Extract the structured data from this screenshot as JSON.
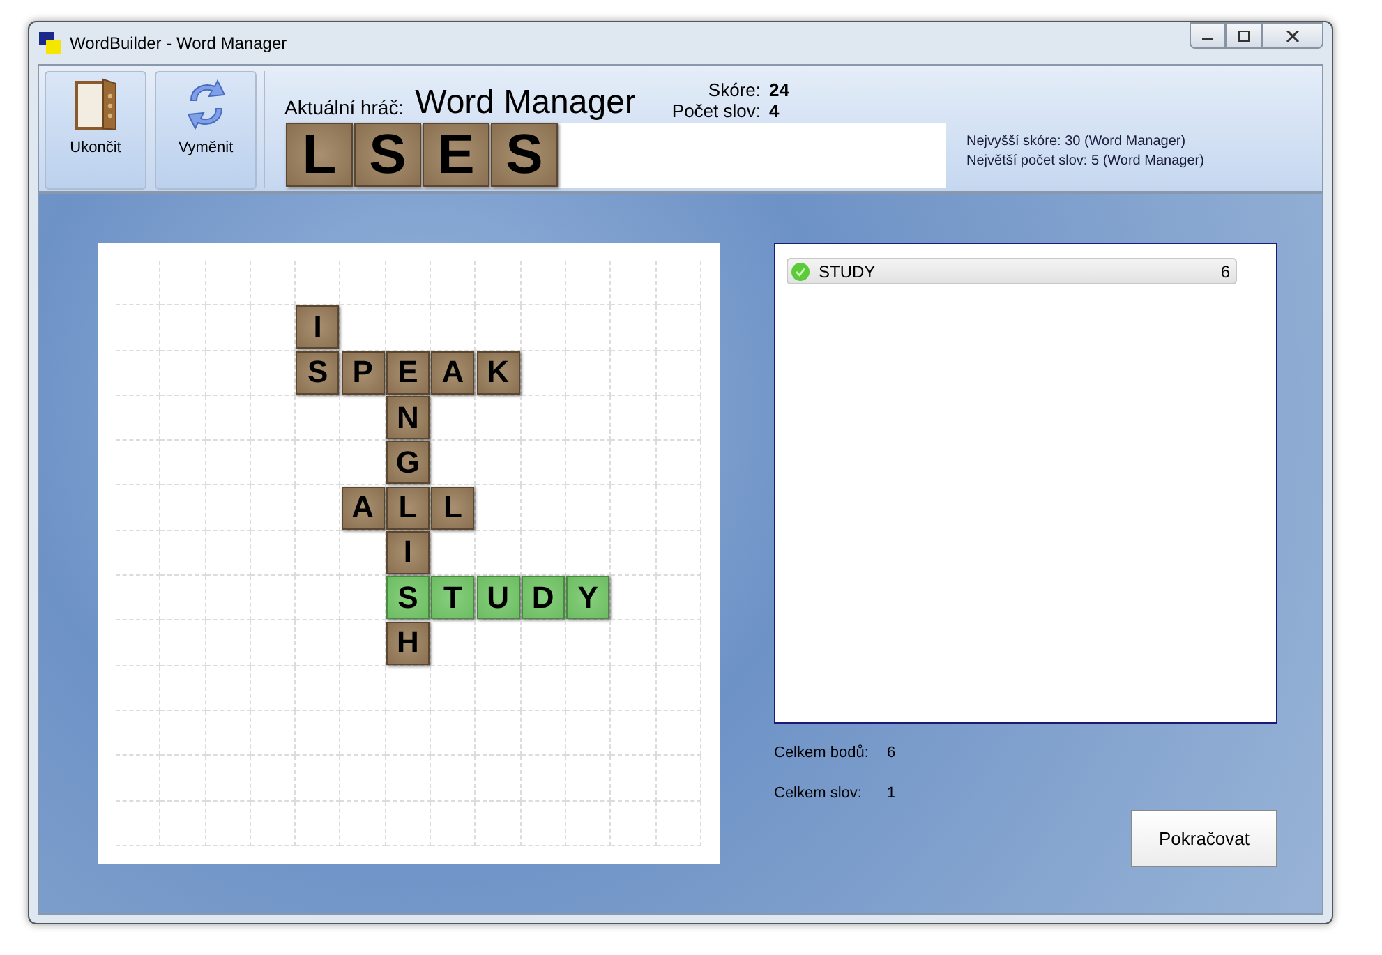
{
  "window": {
    "title": "WordBuilder - Word Manager"
  },
  "toolbar": {
    "buttons": [
      {
        "kind": "door",
        "label": "Ukončit"
      },
      {
        "kind": "swap",
        "label": "Vyměnit"
      }
    ]
  },
  "player": {
    "label": "Aktuální hráč:",
    "name": "Word Manager",
    "score_label": "Skóre:",
    "score": "24",
    "words_label": "Počet slov:",
    "words": "4"
  },
  "rack": {
    "tiles": [
      "L",
      "S",
      "E",
      "S"
    ]
  },
  "records": [
    "Nejvyšší skóre: 30 (Word Manager)",
    "Největší počet slov: 5 (Word Manager)"
  ],
  "board": {
    "rows": [
      [
        null,
        null,
        null,
        null,
        null,
        null,
        null,
        null,
        null,
        null,
        null,
        null,
        null
      ],
      [
        null,
        null,
        null,
        null,
        {
          "letter": "I",
          "new": false
        },
        null,
        null,
        null,
        null,
        null,
        null,
        null,
        null
      ],
      [
        null,
        null,
        null,
        null,
        {
          "letter": "S",
          "new": false
        },
        {
          "letter": "P",
          "new": false
        },
        {
          "letter": "E",
          "new": false
        },
        {
          "letter": "A",
          "new": false
        },
        {
          "letter": "K",
          "new": false
        },
        null,
        null,
        null,
        null
      ],
      [
        null,
        null,
        null,
        null,
        null,
        null,
        {
          "letter": "N",
          "new": false
        },
        null,
        null,
        null,
        null,
        null,
        null
      ],
      [
        null,
        null,
        null,
        null,
        null,
        null,
        {
          "letter": "G",
          "new": false
        },
        null,
        null,
        null,
        null,
        null,
        null
      ],
      [
        null,
        null,
        null,
        null,
        null,
        {
          "letter": "A",
          "new": false
        },
        {
          "letter": "L",
          "new": false
        },
        {
          "letter": "L",
          "new": false
        },
        null,
        null,
        null,
        null,
        null
      ],
      [
        null,
        null,
        null,
        null,
        null,
        null,
        {
          "letter": "I",
          "new": false
        },
        null,
        null,
        null,
        null,
        null,
        null
      ],
      [
        null,
        null,
        null,
        null,
        null,
        null,
        {
          "letter": "S",
          "new": true
        },
        {
          "letter": "T",
          "new": true
        },
        {
          "letter": "U",
          "new": true
        },
        {
          "letter": "D",
          "new": true
        },
        {
          "letter": "Y",
          "new": true
        },
        null,
        null
      ],
      [
        null,
        null,
        null,
        null,
        null,
        null,
        {
          "letter": "H",
          "new": false
        },
        null,
        null,
        null,
        null,
        null,
        null
      ],
      [
        null,
        null,
        null,
        null,
        null,
        null,
        null,
        null,
        null,
        null,
        null,
        null,
        null
      ],
      [
        null,
        null,
        null,
        null,
        null,
        null,
        null,
        null,
        null,
        null,
        null,
        null,
        null
      ],
      [
        null,
        null,
        null,
        null,
        null,
        null,
        null,
        null,
        null,
        null,
        null,
        null,
        null
      ],
      [
        null,
        null,
        null,
        null,
        null,
        null,
        null,
        null,
        null,
        null,
        null,
        null,
        null
      ]
    ]
  },
  "word_list": [
    {
      "word": "STUDY",
      "points": "6",
      "valid": true
    }
  ],
  "totals": [
    {
      "label": "Celkem bodů:",
      "value": "6"
    },
    {
      "label": "Celkem slov:",
      "value": "1"
    }
  ],
  "continue_button": "Pokračovat"
}
